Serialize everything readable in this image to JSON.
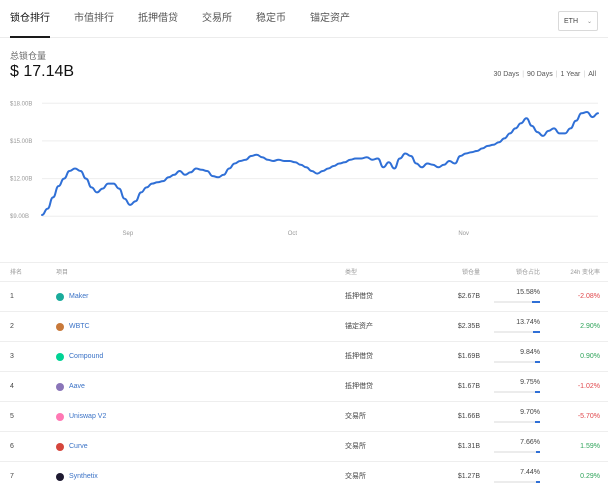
{
  "nav": {
    "tabs": [
      {
        "label": "锁仓排行",
        "active": true
      },
      {
        "label": "市值排行",
        "active": false
      },
      {
        "label": "抵押借贷",
        "active": false
      },
      {
        "label": "交易所",
        "active": false
      },
      {
        "label": "稳定币",
        "active": false
      },
      {
        "label": "锚定资产",
        "active": false
      }
    ],
    "asset_selector": {
      "value": "ETH",
      "icon": "chevron-down-icon"
    }
  },
  "summary": {
    "label": "总锁仓量",
    "value": "$ 17.14B"
  },
  "ranges": [
    "30 Days",
    "90 Days",
    "1 Year",
    "All"
  ],
  "chart_data": {
    "type": "line",
    "title": "",
    "xlabel": "",
    "ylabel": "",
    "ylim": [
      8.7,
      18.1
    ],
    "x_domain": [
      "2019-08-21",
      "2019-11-30"
    ],
    "y_ticks": [
      9,
      12,
      15,
      18
    ],
    "y_tick_labels": [
      "$9.00B",
      "$12.00B",
      "$15.00B",
      "$18.00B"
    ],
    "x_ticks": [
      "2019-09-01",
      "2019-10-01",
      "2019-11-01"
    ],
    "x_tick_labels": [
      "Sep",
      "Oct",
      "Nov"
    ],
    "grid": true,
    "color": "#2f6fd6",
    "series": [
      {
        "x": [
          "2019-08-21",
          "2019-08-22",
          "2019-08-23",
          "2019-08-24",
          "2019-08-25",
          "2019-08-26",
          "2019-08-27",
          "2019-08-28",
          "2019-08-29",
          "2019-08-30",
          "2019-08-31",
          "2019-09-01",
          "2019-09-02",
          "2019-09-03",
          "2019-09-04",
          "2019-09-05",
          "2019-09-06",
          "2019-09-07",
          "2019-09-08",
          "2019-09-09",
          "2019-09-10",
          "2019-09-11",
          "2019-09-12",
          "2019-09-13",
          "2019-09-14",
          "2019-09-15",
          "2019-09-16",
          "2019-09-17",
          "2019-09-18",
          "2019-09-19",
          "2019-09-20",
          "2019-09-21",
          "2019-09-22",
          "2019-09-23",
          "2019-09-24",
          "2019-09-25",
          "2019-09-26",
          "2019-09-27",
          "2019-09-28",
          "2019-09-29",
          "2019-09-30",
          "2019-10-01",
          "2019-10-02",
          "2019-10-03",
          "2019-10-04",
          "2019-10-05",
          "2019-10-06",
          "2019-10-07",
          "2019-10-08",
          "2019-10-09",
          "2019-10-10",
          "2019-10-11",
          "2019-10-12",
          "2019-10-13",
          "2019-10-14",
          "2019-10-15",
          "2019-10-16",
          "2019-10-17",
          "2019-10-18",
          "2019-10-19",
          "2019-10-20",
          "2019-10-21",
          "2019-10-22",
          "2019-10-23",
          "2019-10-24",
          "2019-10-25",
          "2019-10-26",
          "2019-10-27",
          "2019-10-28",
          "2019-10-29",
          "2019-10-30",
          "2019-10-31",
          "2019-11-01",
          "2019-11-02",
          "2019-11-03",
          "2019-11-04",
          "2019-11-05",
          "2019-11-06",
          "2019-11-07",
          "2019-11-08",
          "2019-11-09",
          "2019-11-10",
          "2019-11-11",
          "2019-11-12",
          "2019-11-13",
          "2019-11-14",
          "2019-11-15",
          "2019-11-16",
          "2019-11-17",
          "2019-11-18",
          "2019-11-19",
          "2019-11-20",
          "2019-11-21",
          "2019-11-22",
          "2019-11-23",
          "2019-11-24",
          "2019-11-25",
          "2019-11-26",
          "2019-11-27",
          "2019-11-28",
          "2019-11-29",
          "2019-11-30"
        ],
        "y": [
          9.1,
          9.6,
          10.5,
          11.4,
          12.0,
          12.6,
          12.8,
          12.6,
          12.0,
          11.3,
          10.9,
          11.2,
          11.6,
          11.6,
          11.2,
          10.4,
          9.9,
          10.2,
          10.9,
          11.3,
          11.6,
          11.7,
          11.8,
          12.1,
          12.3,
          12.6,
          12.3,
          12.5,
          12.8,
          12.7,
          12.6,
          12.2,
          12.1,
          12.3,
          12.8,
          13.2,
          13.4,
          13.5,
          13.8,
          13.9,
          13.7,
          13.5,
          13.4,
          13.5,
          13.4,
          13.4,
          13.3,
          13.1,
          12.9,
          12.6,
          12.4,
          12.6,
          12.8,
          13.0,
          13.2,
          13.3,
          13.5,
          13.6,
          13.6,
          13.7,
          13.5,
          13.6,
          12.9,
          13.3,
          12.8,
          13.6,
          14.0,
          13.8,
          13.2,
          12.9,
          13.2,
          13.1,
          12.9,
          13.1,
          13.4,
          13.2,
          13.8,
          14.0,
          14.1,
          14.2,
          14.4,
          14.6,
          14.7,
          14.9,
          15.2,
          15.6,
          16.0,
          16.4,
          16.8,
          16.2,
          15.7,
          15.4,
          15.8,
          16.0,
          15.6,
          15.6,
          16.0,
          16.6,
          17.2,
          17.3,
          16.9,
          17.2
        ]
      }
    ]
  },
  "table": {
    "headers": {
      "rank": "排名",
      "project": "项目",
      "category": "类型",
      "tvl": "锁仓量",
      "share": "锁仓占比",
      "change": "24h 变化率"
    },
    "rows": [
      {
        "rank": "1",
        "name": "Maker",
        "icon": "maker-icon",
        "icon_color": "#1aab9b",
        "category": "抵押借贷",
        "tvl": "$2.67B",
        "share": "15.58%",
        "share_value": 15.58,
        "change": "-2.08%",
        "change_dir": "neg"
      },
      {
        "rank": "2",
        "name": "WBTC",
        "icon": "wbtc-icon",
        "icon_color": "#c8793a",
        "category": "锚定资产",
        "tvl": "$2.35B",
        "share": "13.74%",
        "share_value": 13.74,
        "change": "2.90%",
        "change_dir": "pos"
      },
      {
        "rank": "3",
        "name": "Compound",
        "icon": "compound-icon",
        "icon_color": "#00d395",
        "category": "抵押借贷",
        "tvl": "$1.69B",
        "share": "9.84%",
        "share_value": 9.84,
        "change": "0.90%",
        "change_dir": "pos"
      },
      {
        "rank": "4",
        "name": "Aave",
        "icon": "aave-icon",
        "icon_color": "#8a75b8",
        "category": "抵押借贷",
        "tvl": "$1.67B",
        "share": "9.75%",
        "share_value": 9.75,
        "change": "-1.02%",
        "change_dir": "neg"
      },
      {
        "rank": "5",
        "name": "Uniswap V2",
        "icon": "uniswap-icon",
        "icon_color": "#ff78b4",
        "category": "交易所",
        "tvl": "$1.66B",
        "share": "9.70%",
        "share_value": 9.7,
        "change": "-5.70%",
        "change_dir": "neg"
      },
      {
        "rank": "6",
        "name": "Curve",
        "icon": "curve-icon",
        "icon_color": "#d5463c",
        "category": "交易所",
        "tvl": "$1.31B",
        "share": "7.66%",
        "share_value": 7.66,
        "change": "1.59%",
        "change_dir": "pos"
      },
      {
        "rank": "7",
        "name": "Synthetix",
        "icon": "synthetix-icon",
        "icon_color": "#1e1a31",
        "category": "交易所",
        "tvl": "$1.27B",
        "share": "7.44%",
        "share_value": 7.44,
        "change": "0.29%",
        "change_dir": "pos"
      }
    ]
  }
}
